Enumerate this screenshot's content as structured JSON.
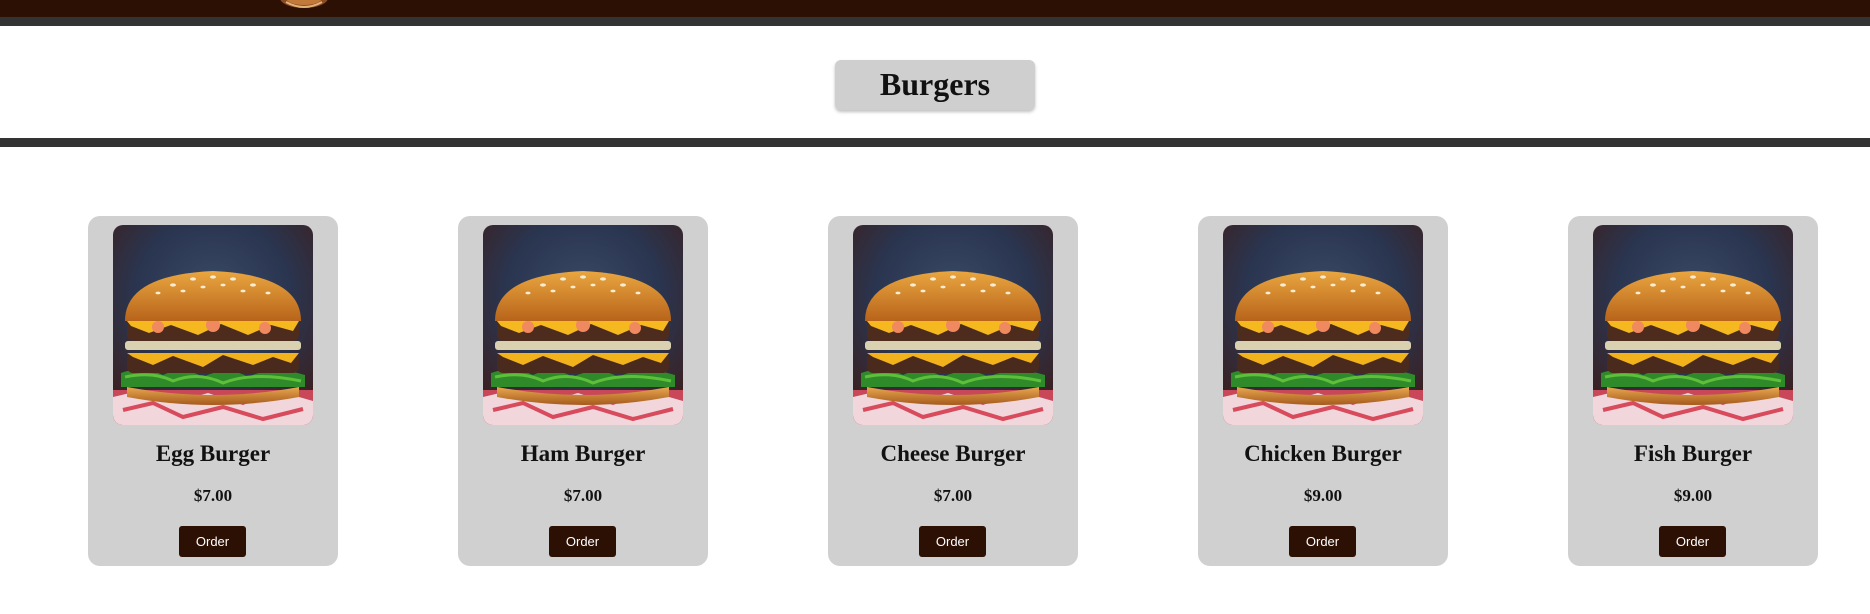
{
  "header": {
    "logo_icon": "restaurant-logo-icon",
    "bar_color": "#2c1004",
    "rule_color": "#333333"
  },
  "section": {
    "title": "Burgers"
  },
  "products": [
    {
      "name": "Egg Burger",
      "price": "$7.00",
      "order_label": "Order",
      "image_icon": "burger-photo"
    },
    {
      "name": "Ham Burger",
      "price": "$7.00",
      "order_label": "Order",
      "image_icon": "burger-photo"
    },
    {
      "name": "Cheese Burger",
      "price": "$7.00",
      "order_label": "Order",
      "image_icon": "burger-photo"
    },
    {
      "name": "Chicken Burger",
      "price": "$9.00",
      "order_label": "Order",
      "image_icon": "burger-photo"
    },
    {
      "name": "Fish Burger",
      "price": "$9.00",
      "order_label": "Order",
      "image_icon": "burger-photo"
    }
  ],
  "colors": {
    "card_background": "#d0d0d0",
    "button_background": "#2c1004",
    "button_text": "#ffffff"
  }
}
